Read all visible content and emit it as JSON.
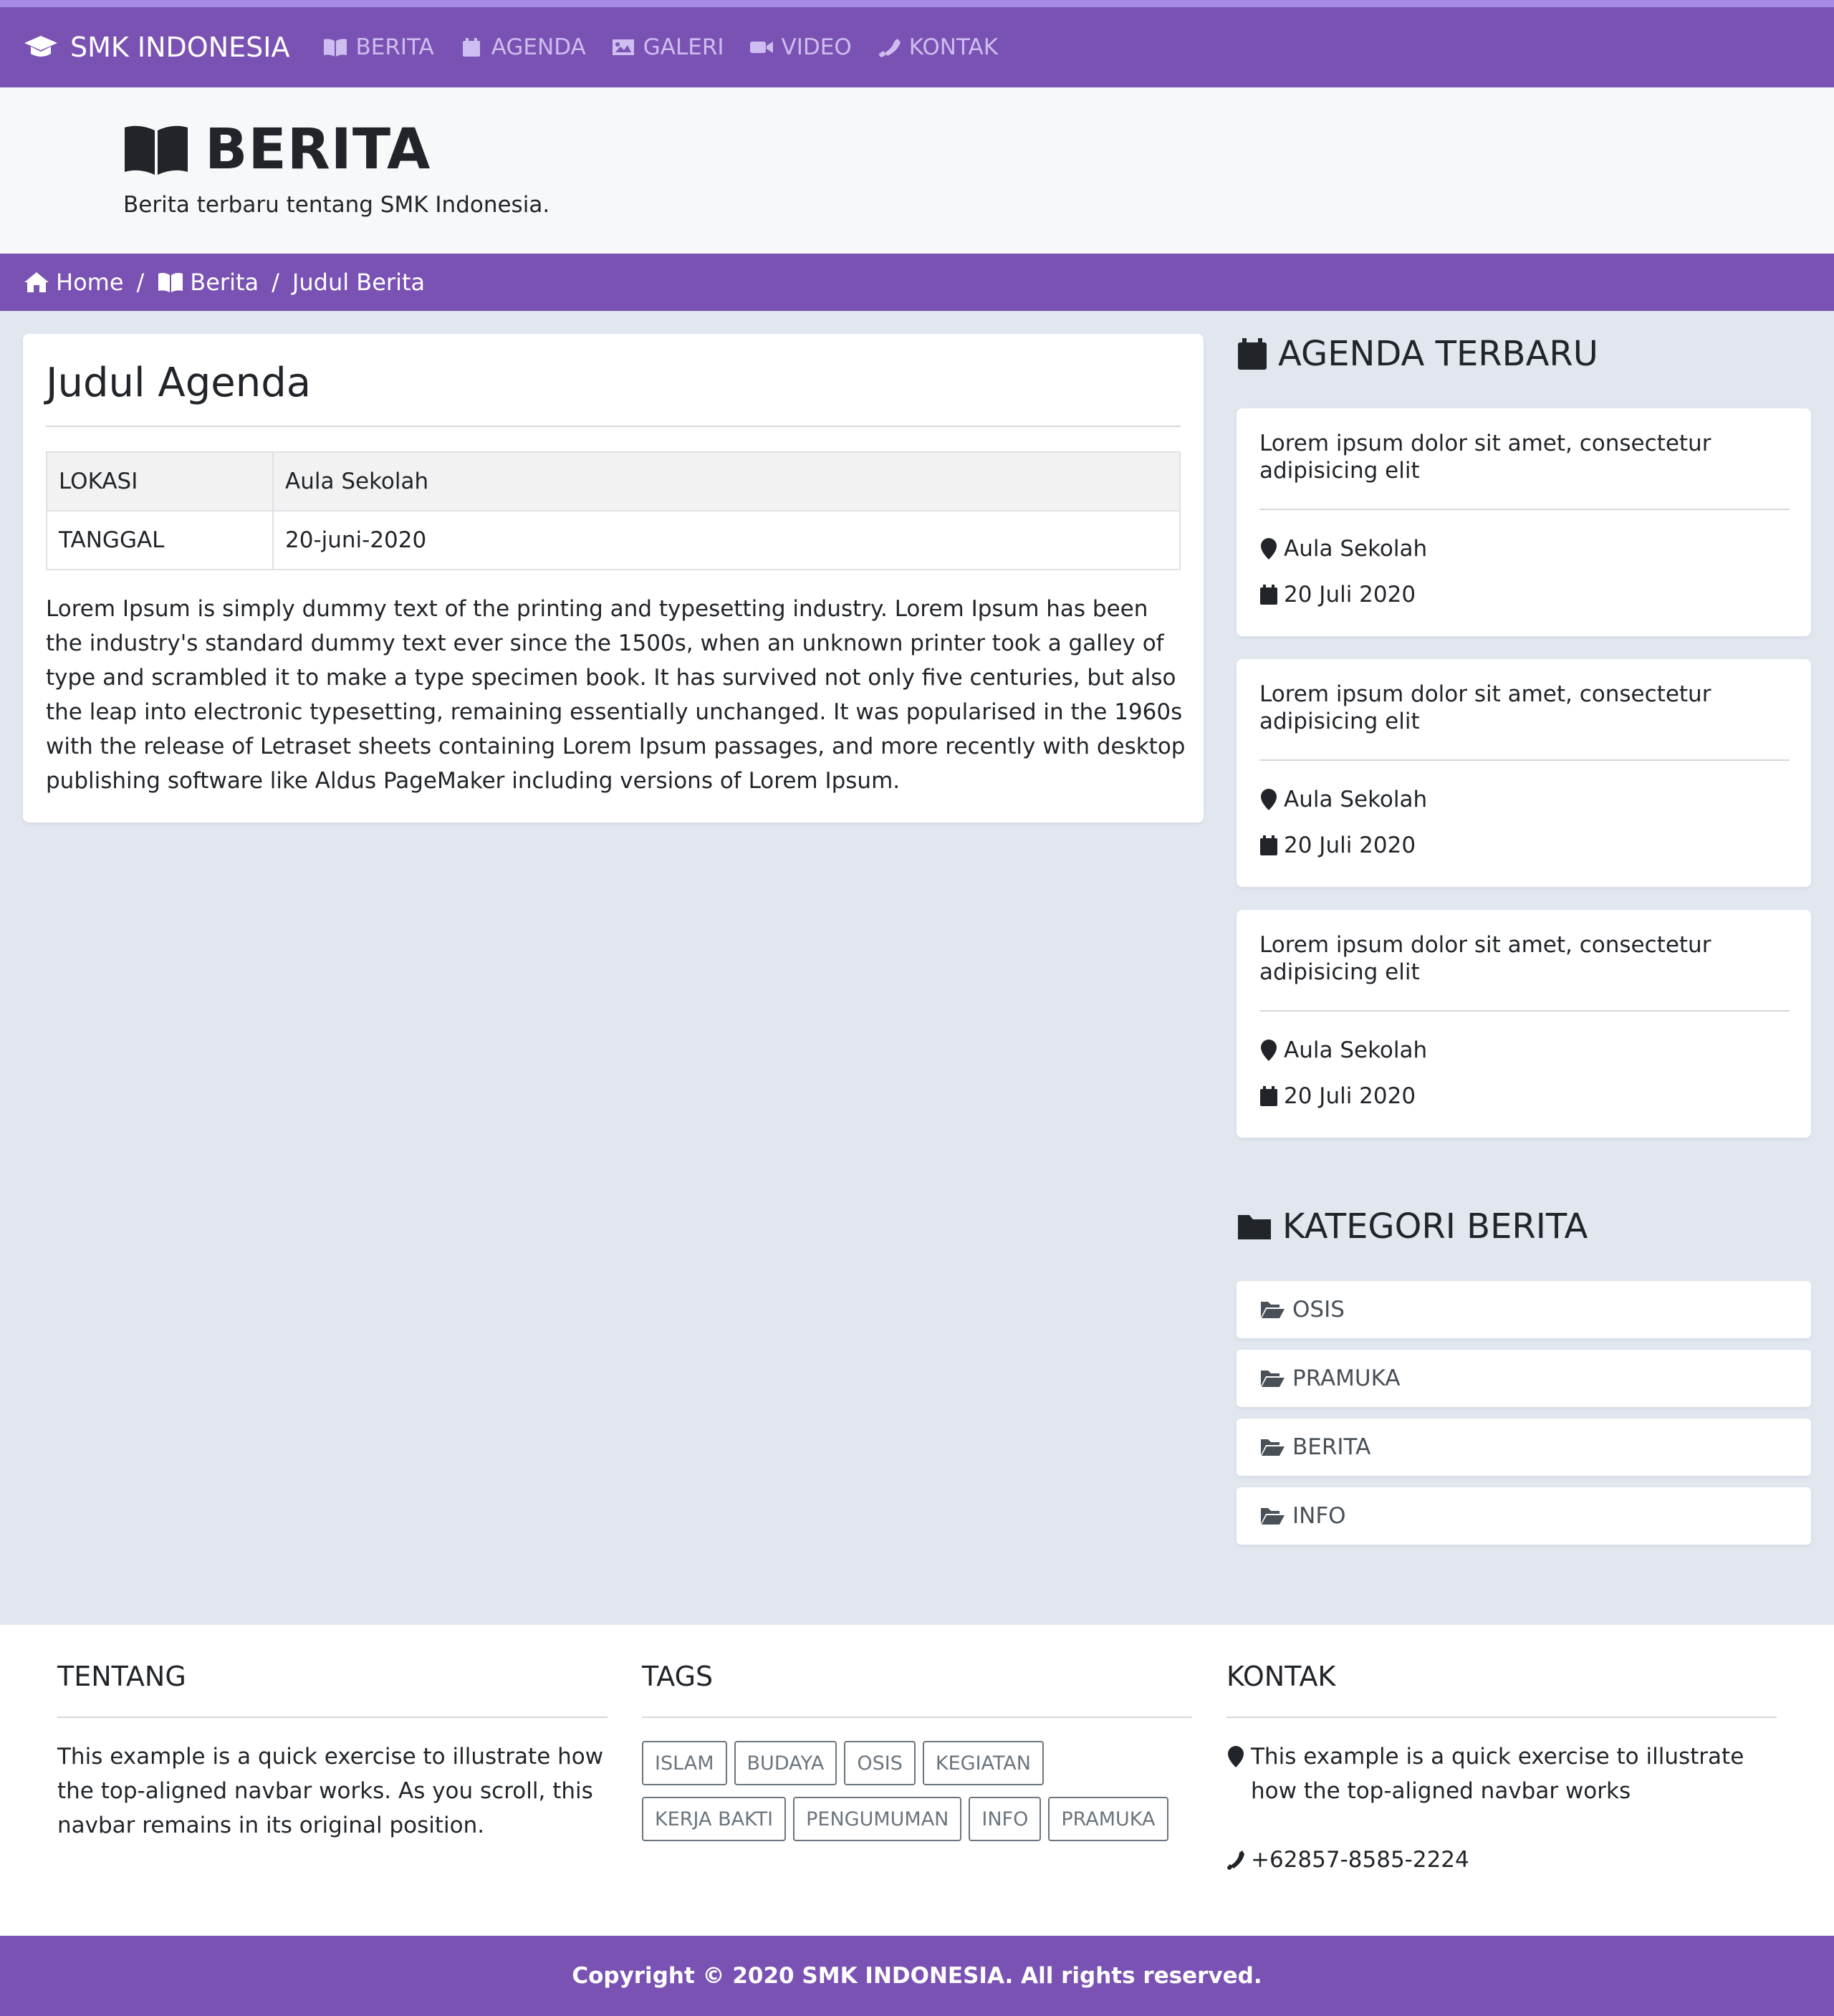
{
  "navbar": {
    "brand": "SMK INDONESIA",
    "links": [
      "BERITA",
      "AGENDA",
      "GALERI",
      "VIDEO",
      "KONTAK"
    ]
  },
  "hero": {
    "title": "BERITA",
    "subtitle": "Berita terbaru tentang SMK Indonesia."
  },
  "breadcrumb": [
    "Home",
    "Berita",
    "Judul Berita"
  ],
  "article": {
    "title": "Judul Agenda",
    "table": [
      {
        "label": "LOKASI",
        "value": "Aula Sekolah"
      },
      {
        "label": "TANGGAL",
        "value": "20-juni-2020"
      }
    ],
    "body": "Lorem Ipsum is simply dummy text of the printing and typesetting industry. Lorem Ipsum has been the industry's standard dummy text ever since the 1500s, when an unknown printer took a galley of type and scrambled it to make a type specimen book. It has survived not only five centuries, but also the leap into electronic typesetting, remaining essentially unchanged. It was popularised in the 1960s with the release of Letraset sheets containing Lorem Ipsum passages, and more recently with desktop publishing software like Aldus PageMaker including versions of Lorem Ipsum."
  },
  "sidebar": {
    "agenda_heading": "AGENDA TERBARU",
    "agenda": [
      {
        "title": "Lorem ipsum dolor sit amet, consectetur adipisicing elit",
        "location": "Aula Sekolah",
        "date": "20 Juli 2020"
      },
      {
        "title": "Lorem ipsum dolor sit amet, consectetur adipisicing elit",
        "location": "Aula Sekolah",
        "date": "20 Juli 2020"
      },
      {
        "title": "Lorem ipsum dolor sit amet, consectetur adipisicing elit",
        "location": "Aula Sekolah",
        "date": "20 Juli 2020"
      }
    ],
    "category_heading": "KATEGORI BERITA",
    "categories": [
      "OSIS",
      "PRAMUKA",
      "BERITA",
      "INFO"
    ]
  },
  "footer": {
    "about_heading": "TENTANG",
    "about_text": "This example is a quick exercise to illustrate how the top-aligned navbar works. As you scroll, this navbar remains in its original position.",
    "tags_heading": "TAGS",
    "tags": [
      "ISLAM",
      "BUDAYA",
      "OSIS",
      "KEGIATAN",
      "KERJA BAKTI",
      "PENGUMUMAN",
      "INFO",
      "PRAMUKA"
    ],
    "contact_heading": "KONTAK",
    "contact_address": "This example is a quick exercise to illustrate how the top-aligned navbar works",
    "contact_phone": "+62857-8585-2224"
  },
  "copyright": "Copyright © 2020 SMK INDONESIA. All rights reserved.",
  "colors": {
    "primary": "#7a52b3",
    "accent_strip": "#a78ae6",
    "background": "#e1e6ef"
  }
}
